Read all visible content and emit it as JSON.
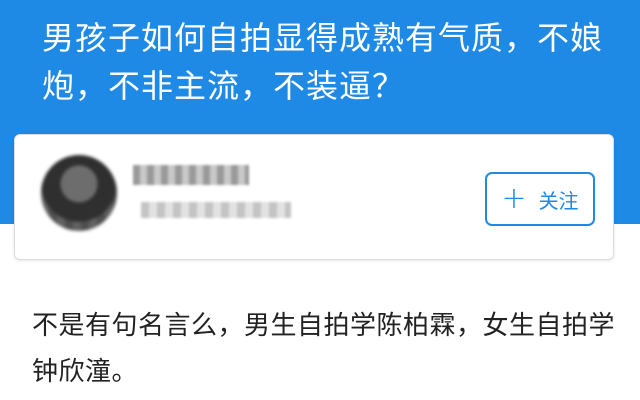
{
  "question": {
    "title": "男孩子如何自拍显得成熟有气质，不娘炮，不非主流，不装逼？"
  },
  "author": {
    "name": "",
    "bio": "",
    "follow_icon": "plus-icon",
    "follow_symbol": "+",
    "follow_label": "关注"
  },
  "answer": {
    "text": "不是有句名言么，男生自拍学陈柏霖，女生自拍学钟欣潼。"
  },
  "colors": {
    "header_bg": "#1e8ae6",
    "accent": "#1e8ae6",
    "card_border": "#d9dde2",
    "body_text": "#222222"
  }
}
